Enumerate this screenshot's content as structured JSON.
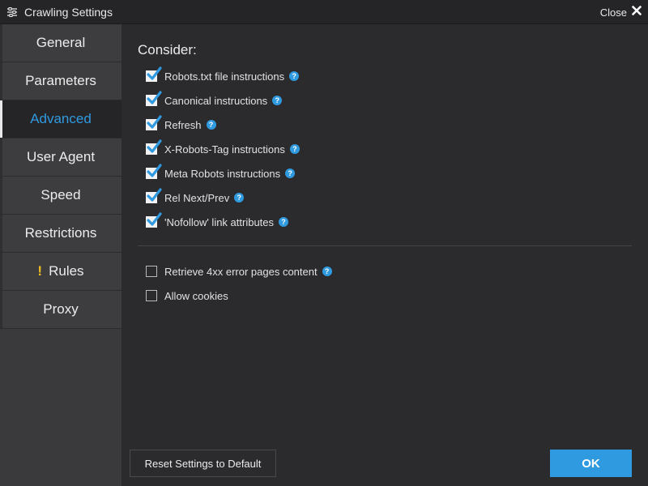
{
  "window": {
    "title": "Crawling Settings",
    "close_label": "Close"
  },
  "sidebar": {
    "items": [
      {
        "label": "General",
        "active": false
      },
      {
        "label": "Parameters",
        "active": false
      },
      {
        "label": "Advanced",
        "active": true
      },
      {
        "label": "User Agent",
        "active": false
      },
      {
        "label": "Speed",
        "active": false
      },
      {
        "label": "Restrictions",
        "active": false
      },
      {
        "label": "Rules",
        "active": false,
        "warning": "!"
      },
      {
        "label": "Proxy",
        "active": false
      }
    ]
  },
  "main": {
    "section_title": "Consider:",
    "options": [
      {
        "label": "Robots.txt file instructions",
        "checked": true,
        "help": true
      },
      {
        "label": "Canonical instructions",
        "checked": true,
        "help": true
      },
      {
        "label": "Refresh",
        "checked": true,
        "help": true
      },
      {
        "label": "X-Robots-Tag instructions",
        "checked": true,
        "help": true
      },
      {
        "label": "Meta Robots instructions",
        "checked": true,
        "help": true
      },
      {
        "label": "Rel Next/Prev",
        "checked": true,
        "help": true
      },
      {
        "label": "'Nofollow' link attributes",
        "checked": true,
        "help": true
      }
    ],
    "extra_options": [
      {
        "label": "Retrieve 4xx error pages content",
        "checked": false,
        "help": true
      },
      {
        "label": "Allow cookies",
        "checked": false,
        "help": false
      }
    ]
  },
  "footer": {
    "reset_label": "Reset Settings to Default",
    "ok_label": "OK"
  },
  "colors": {
    "accent": "#2f9ae0",
    "warning": "#f2c01e",
    "background": "#2b2b2e",
    "sidebar": "#3a3a3d"
  }
}
